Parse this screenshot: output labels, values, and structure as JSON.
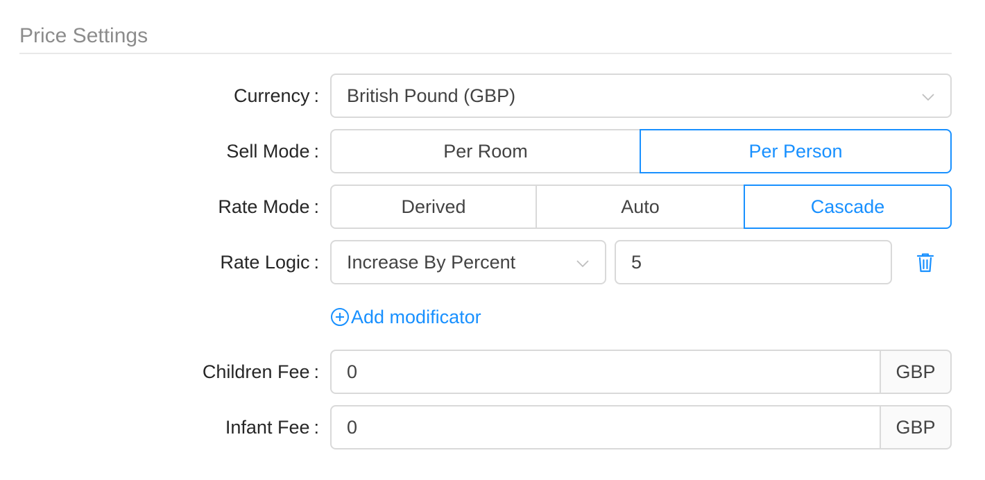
{
  "section": {
    "title": "Price Settings"
  },
  "form": {
    "currency": {
      "label": "Currency",
      "value": "British Pound (GBP)"
    },
    "sell_mode": {
      "label": "Sell Mode",
      "options": [
        "Per Room",
        "Per Person"
      ],
      "selected": "Per Person"
    },
    "rate_mode": {
      "label": "Rate Mode",
      "options": [
        "Derived",
        "Auto",
        "Cascade"
      ],
      "selected": "Cascade"
    },
    "rate_logic": {
      "label": "Rate Logic",
      "type_value": "Increase By Percent",
      "amount_value": "5"
    },
    "add_modificator": {
      "label": "Add modificator"
    },
    "children_fee": {
      "label": "Children Fee",
      "value": "0",
      "unit": "GBP"
    },
    "infant_fee": {
      "label": "Infant Fee",
      "value": "0",
      "unit": "GBP"
    },
    "colon": ":"
  },
  "colors": {
    "accent": "#1890ff",
    "border": "#d9d9d9",
    "title": "#8c8c8c"
  },
  "icons": [
    "chevron-down-icon",
    "trash-icon",
    "plus-circle-icon"
  ]
}
